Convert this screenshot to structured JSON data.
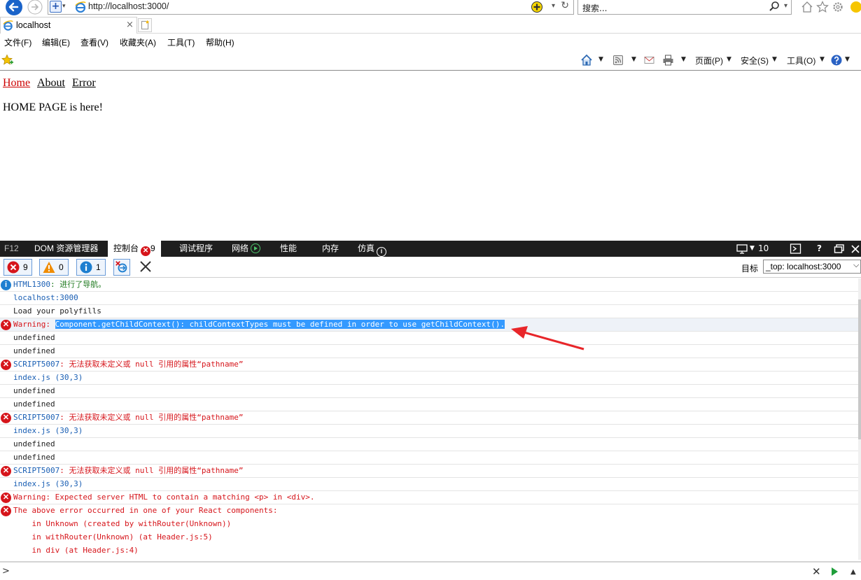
{
  "browser": {
    "url": "http://localhost:3000/",
    "search_placeholder": "搜索...",
    "tab_title": "localhost",
    "tab_close": "×"
  },
  "menu": [
    "文件(F)",
    "编辑(E)",
    "查看(V)",
    "收藏夹(A)",
    "工具(T)",
    "帮助(H)"
  ],
  "command_bar": {
    "page": "页面(P)",
    "safety": "安全(S)",
    "tools": "工具(O)"
  },
  "page": {
    "nav_links": [
      "Home",
      "About",
      "Error"
    ],
    "active_link": "Home",
    "body_text": "HOME PAGE is here!"
  },
  "devtools": {
    "f12_label": "F12",
    "tabs": [
      "DOM 资源管理器",
      "控制台",
      "调试程序",
      "网络",
      "性能",
      "内存",
      "仿真"
    ],
    "active_tab": "控制台",
    "console_error_badge": "9",
    "target_mode": "10",
    "help": "?",
    "filters": {
      "errors": "9",
      "warnings": "0",
      "info": "1"
    },
    "target_label": "目标",
    "target_value": "_top: localhost:3000",
    "colors": {
      "error": "#d6151b",
      "info": "#1e7fd0",
      "selection": "#3399ff",
      "link": "#1a5fb4"
    },
    "console": [
      {
        "icon": "info",
        "prefix": "HTML1300",
        "text": ": 进行了导航。",
        "color": "green"
      },
      {
        "icon": "",
        "text": "localhost:3000",
        "color": "blue"
      },
      {
        "icon": "",
        "text": "Load your polyfills",
        "color": "plain"
      },
      {
        "icon": "err",
        "prefix": "Warning: ",
        "text": "Component.getChildContext(): childContextTypes must be defined in order to use getChildContext().",
        "color": "red",
        "selected": true
      },
      {
        "icon": "",
        "text": "undefined",
        "color": "plain"
      },
      {
        "icon": "",
        "text": "undefined",
        "color": "plain"
      },
      {
        "icon": "err",
        "prefix": "SCRIPT5007",
        "text": ": 无法获取未定义或 null 引用的属性“pathname”",
        "color": "red"
      },
      {
        "icon": "",
        "text": "index.js (30,3)",
        "color": "blue"
      },
      {
        "icon": "",
        "text": "undefined",
        "color": "plain"
      },
      {
        "icon": "",
        "text": "undefined",
        "color": "plain"
      },
      {
        "icon": "err",
        "prefix": "SCRIPT5007",
        "text": ": 无法获取未定义或 null 引用的属性“pathname”",
        "color": "red"
      },
      {
        "icon": "",
        "text": "index.js (30,3)",
        "color": "blue"
      },
      {
        "icon": "",
        "text": "undefined",
        "color": "plain"
      },
      {
        "icon": "",
        "text": "undefined",
        "color": "plain"
      },
      {
        "icon": "err",
        "prefix": "SCRIPT5007",
        "text": ": 无法获取未定义或 null 引用的属性“pathname”",
        "color": "red"
      },
      {
        "icon": "",
        "text": "index.js (30,3)",
        "color": "blue"
      },
      {
        "icon": "err",
        "prefix": "",
        "text": "Warning: Expected server HTML to contain a matching <p> in <div>.",
        "color": "red"
      },
      {
        "icon": "err",
        "prefix": "",
        "text": "The above error occurred in one of your React components:",
        "color": "red",
        "cont": true
      },
      {
        "icon": "",
        "text": "    in Unknown (created by withRouter(Unknown))",
        "color": "red",
        "cont": true
      },
      {
        "icon": "",
        "text": "    in withRouter(Unknown) (at Header.js:5)",
        "color": "red",
        "cont": true
      },
      {
        "icon": "",
        "text": "    in div (at Header.js:4)",
        "color": "red",
        "cont": true
      }
    ],
    "prompt": ">"
  }
}
